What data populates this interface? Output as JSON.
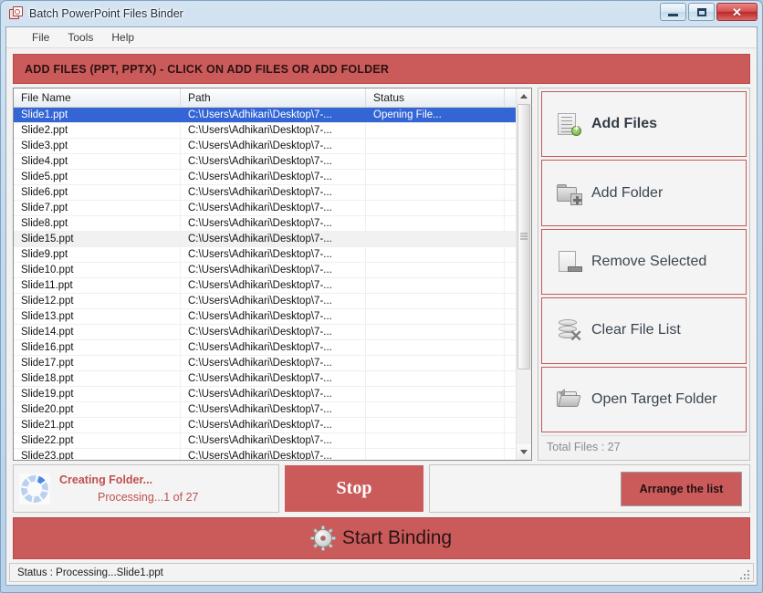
{
  "window": {
    "title": "Batch PowerPoint Files Binder",
    "app_icon": "powerpoint-binder-icon",
    "minimize_label": "–",
    "maximize_label": "□",
    "close_label": "✕"
  },
  "menu": {
    "items": [
      {
        "label": "File"
      },
      {
        "label": "Tools"
      },
      {
        "label": "Help"
      }
    ]
  },
  "banner": {
    "text": "ADD FILES (PPT, PPTX) - CLICK ON ADD FILES OR ADD FOLDER",
    "color": "#cb5b5b"
  },
  "file_list": {
    "columns": [
      "File Name",
      "Path",
      "Status"
    ],
    "rows": [
      {
        "name": "Slide1.ppt",
        "path": "C:\\Users\\Adhikari\\Desktop\\7-...",
        "status": "Opening File...",
        "state": "selected"
      },
      {
        "name": "Slide2.ppt",
        "path": "C:\\Users\\Adhikari\\Desktop\\7-...",
        "status": "",
        "state": "normal"
      },
      {
        "name": "Slide3.ppt",
        "path": "C:\\Users\\Adhikari\\Desktop\\7-...",
        "status": "",
        "state": "normal"
      },
      {
        "name": "Slide4.ppt",
        "path": "C:\\Users\\Adhikari\\Desktop\\7-...",
        "status": "",
        "state": "normal"
      },
      {
        "name": "Slide5.ppt",
        "path": "C:\\Users\\Adhikari\\Desktop\\7-...",
        "status": "",
        "state": "normal"
      },
      {
        "name": "Slide6.ppt",
        "path": "C:\\Users\\Adhikari\\Desktop\\7-...",
        "status": "",
        "state": "normal"
      },
      {
        "name": "Slide7.ppt",
        "path": "C:\\Users\\Adhikari\\Desktop\\7-...",
        "status": "",
        "state": "normal"
      },
      {
        "name": "Slide8.ppt",
        "path": "C:\\Users\\Adhikari\\Desktop\\7-...",
        "status": "",
        "state": "normal"
      },
      {
        "name": "Slide15.ppt",
        "path": "C:\\Users\\Adhikari\\Desktop\\7-...",
        "status": "",
        "state": "hovered"
      },
      {
        "name": "Slide9.ppt",
        "path": "C:\\Users\\Adhikari\\Desktop\\7-...",
        "status": "",
        "state": "normal"
      },
      {
        "name": "Slide10.ppt",
        "path": "C:\\Users\\Adhikari\\Desktop\\7-...",
        "status": "",
        "state": "normal"
      },
      {
        "name": "Slide11.ppt",
        "path": "C:\\Users\\Adhikari\\Desktop\\7-...",
        "status": "",
        "state": "normal"
      },
      {
        "name": "Slide12.ppt",
        "path": "C:\\Users\\Adhikari\\Desktop\\7-...",
        "status": "",
        "state": "normal"
      },
      {
        "name": "Slide13.ppt",
        "path": "C:\\Users\\Adhikari\\Desktop\\7-...",
        "status": "",
        "state": "normal"
      },
      {
        "name": "Slide14.ppt",
        "path": "C:\\Users\\Adhikari\\Desktop\\7-...",
        "status": "",
        "state": "normal"
      },
      {
        "name": "Slide16.ppt",
        "path": "C:\\Users\\Adhikari\\Desktop\\7-...",
        "status": "",
        "state": "normal"
      },
      {
        "name": "Slide17.ppt",
        "path": "C:\\Users\\Adhikari\\Desktop\\7-...",
        "status": "",
        "state": "normal"
      },
      {
        "name": "Slide18.ppt",
        "path": "C:\\Users\\Adhikari\\Desktop\\7-...",
        "status": "",
        "state": "normal"
      },
      {
        "name": "Slide19.ppt",
        "path": "C:\\Users\\Adhikari\\Desktop\\7-...",
        "status": "",
        "state": "normal"
      },
      {
        "name": "Slide20.ppt",
        "path": "C:\\Users\\Adhikari\\Desktop\\7-...",
        "status": "",
        "state": "normal"
      },
      {
        "name": "Slide21.ppt",
        "path": "C:\\Users\\Adhikari\\Desktop\\7-...",
        "status": "",
        "state": "normal"
      },
      {
        "name": "Slide22.ppt",
        "path": "C:\\Users\\Adhikari\\Desktop\\7-...",
        "status": "",
        "state": "normal"
      },
      {
        "name": "Slide23.ppt",
        "path": "C:\\Users\\Adhikari\\Desktop\\7-...",
        "status": "",
        "state": "normal"
      }
    ],
    "scrollbar": {
      "up_arrow": "scroll-up-arrow",
      "down_arrow": "scroll-down-arrow",
      "thumb_top_pct": 0,
      "thumb_height_pct": 78
    }
  },
  "actions": {
    "buttons": [
      {
        "label": "Add Files",
        "icon": "add-files-icon",
        "emphasis": "primary"
      },
      {
        "label": "Add Folder",
        "icon": "add-folder-icon",
        "emphasis": "normal"
      },
      {
        "label": "Remove Selected",
        "icon": "remove-selected-icon",
        "emphasis": "normal"
      },
      {
        "label": "Clear File List",
        "icon": "clear-file-list-icon",
        "emphasis": "normal"
      },
      {
        "label": "Open Target Folder",
        "icon": "open-target-folder-icon",
        "emphasis": "normal"
      }
    ],
    "total_files": "Total Files : 27"
  },
  "progress": {
    "spinner": "loading-spinner-icon",
    "title": "Creating Folder...",
    "subtitle": "Processing...1 of 27",
    "stop_label": "Stop",
    "arrange_label": "Arrange the list"
  },
  "start": {
    "label": "Start Binding",
    "icon": "gear-icon",
    "color": "#cb5b5b"
  },
  "statusbar": {
    "text": "Status  :  Processing...Slide1.ppt",
    "grip": "resize-grip-icon"
  }
}
